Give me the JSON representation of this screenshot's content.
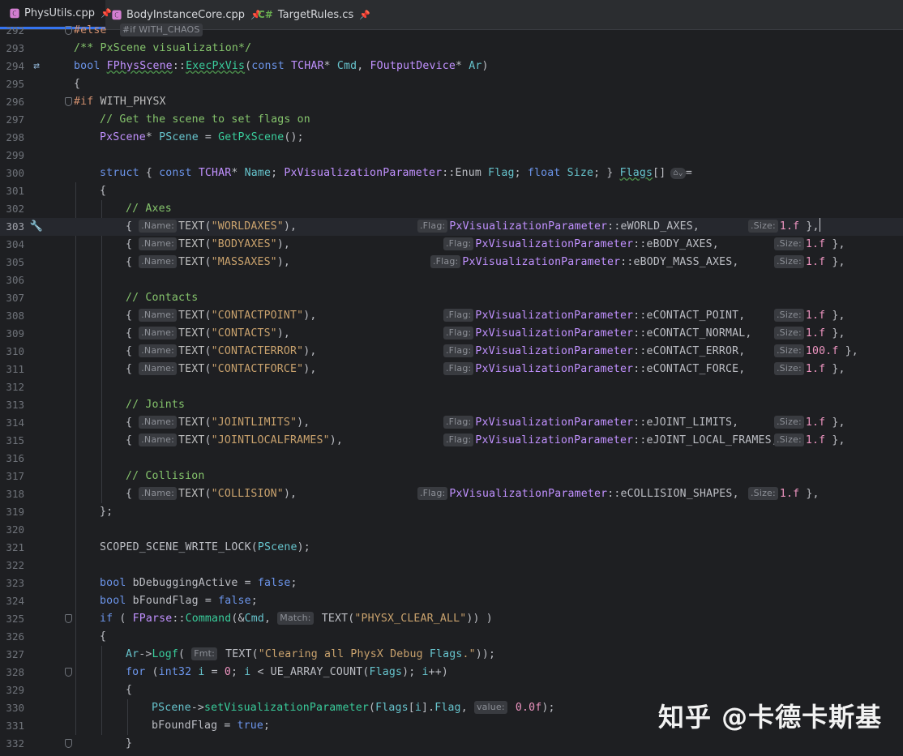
{
  "tabs": [
    {
      "name": "PhysUtils.cpp",
      "icon": "cpp-file-icon",
      "active": true
    },
    {
      "name": "BodyInstanceCore.cpp",
      "icon": "cpp-file-icon",
      "active": false
    },
    {
      "name": "TargetRules.cs",
      "icon": "csharp-file-icon",
      "active": false
    }
  ],
  "tab_icon_cs": "C#",
  "editor": {
    "current_line": 303,
    "lines": [
      {
        "n": "292",
        "text": "#else  #if WITH_CHAOS"
      },
      {
        "n": "293",
        "text": "/** PxScene visualization*/"
      },
      {
        "n": "294",
        "text": "bool FPhysScene::ExecPxVis(const TCHAR* Cmd, FOutputDevice* Ar)"
      },
      {
        "n": "295",
        "text": "{"
      },
      {
        "n": "296",
        "text": "#if WITH_PHYSX"
      },
      {
        "n": "297",
        "text": "// Get the scene to set flags on"
      },
      {
        "n": "298",
        "text": "PxScene* PScene = GetPxScene();"
      },
      {
        "n": "299",
        "text": ""
      },
      {
        "n": "300",
        "text": "struct { const TCHAR* Name; PxVisualizationParameter::Enum Flag; float Size; } Flags[] ="
      },
      {
        "n": "301",
        "text": "{"
      },
      {
        "n": "302",
        "text": "// Axes"
      },
      {
        "n": "303",
        "text": "{ .Name: TEXT(\"WORLDAXES\"), .Flag: PxVisualizationParameter::eWORLD_AXES, .Size: 1.f },"
      },
      {
        "n": "304",
        "text": "{ .Name: TEXT(\"BODYAXES\"), .Flag: PxVisualizationParameter::eBODY_AXES, .Size: 1.f },"
      },
      {
        "n": "305",
        "text": "{ .Name: TEXT(\"MASSAXES\"), .Flag: PxVisualizationParameter::eBODY_MASS_AXES, .Size: 1.f },"
      },
      {
        "n": "306",
        "text": ""
      },
      {
        "n": "307",
        "text": "// Contacts"
      },
      {
        "n": "308",
        "text": "{ .Name: TEXT(\"CONTACTPOINT\"), .Flag: PxVisualizationParameter::eCONTACT_POINT, .Size: 1.f },"
      },
      {
        "n": "309",
        "text": "{ .Name: TEXT(\"CONTACTS\"), .Flag: PxVisualizationParameter::eCONTACT_NORMAL, .Size: 1.f },"
      },
      {
        "n": "310",
        "text": "{ .Name: TEXT(\"CONTACTERROR\"), .Flag: PxVisualizationParameter::eCONTACT_ERROR, .Size: 100.f },"
      },
      {
        "n": "311",
        "text": "{ .Name: TEXT(\"CONTACTFORCE\"), .Flag: PxVisualizationParameter::eCONTACT_FORCE, .Size: 1.f },"
      },
      {
        "n": "312",
        "text": ""
      },
      {
        "n": "313",
        "text": "// Joints"
      },
      {
        "n": "314",
        "text": "{ .Name: TEXT(\"JOINTLIMITS\"), .Flag: PxVisualizationParameter::eJOINT_LIMITS, .Size: 1.f },"
      },
      {
        "n": "315",
        "text": "{ .Name: TEXT(\"JOINTLOCALFRAMES\"), .Flag: PxVisualizationParameter::eJOINT_LOCAL_FRAMES, .Size: 1.f },"
      },
      {
        "n": "316",
        "text": ""
      },
      {
        "n": "317",
        "text": "// Collision"
      },
      {
        "n": "318",
        "text": "{ .Name: TEXT(\"COLLISION\"), .Flag: PxVisualizationParameter::eCOLLISION_SHAPES, .Size: 1.f },"
      },
      {
        "n": "319",
        "text": "};"
      },
      {
        "n": "320",
        "text": ""
      },
      {
        "n": "321",
        "text": "SCOPED_SCENE_WRITE_LOCK(PScene);"
      },
      {
        "n": "322",
        "text": ""
      },
      {
        "n": "323",
        "text": "bool bDebuggingActive = false;"
      },
      {
        "n": "324",
        "text": "bool bFoundFlag = false;"
      },
      {
        "n": "325",
        "text": "if ( FParse::Command(&Cmd, Match: TEXT(\"PHYSX_CLEAR_ALL\")) )"
      },
      {
        "n": "326",
        "text": "{"
      },
      {
        "n": "327",
        "text": "Ar->Logf( Fmt: TEXT(\"Clearing all PhysX Debug Flags.\"));"
      },
      {
        "n": "328",
        "text": "for (int32 i = 0; i < UE_ARRAY_COUNT(Flags); i++)"
      },
      {
        "n": "329",
        "text": "{"
      },
      {
        "n": "330",
        "text": "PScene->setVisualizationParameter(Flags[i].Flag, value: 0.0f);"
      },
      {
        "n": "331",
        "text": "bFoundFlag = true;"
      },
      {
        "n": "332",
        "text": "}"
      }
    ]
  },
  "watermark": "知乎 @卡德卡斯基",
  "colors": {
    "background": "#1e1f22",
    "keyword": "#cf8e6d",
    "function": "#39cc9b",
    "string": "#c9a26d",
    "comment": "#85c46c",
    "type": "#c191ff",
    "number": "#ed94c0",
    "accent": "#3574f0"
  }
}
